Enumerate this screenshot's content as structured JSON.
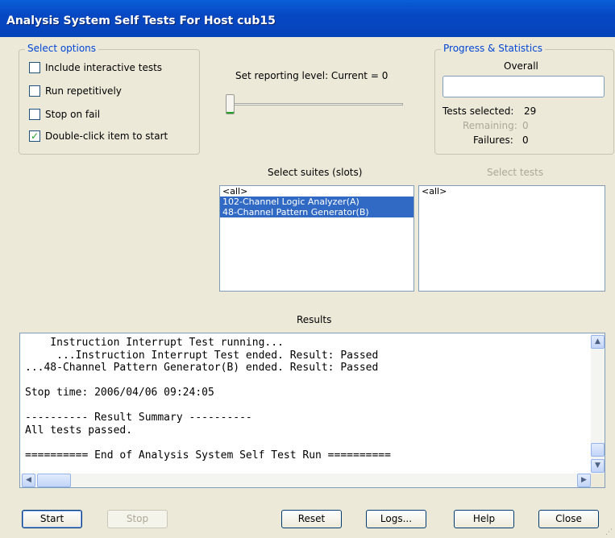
{
  "window": {
    "title": "Analysis System Self Tests For Host cub15"
  },
  "options": {
    "legend": "Select options",
    "items": [
      {
        "label": "Include interactive tests",
        "checked": false
      },
      {
        "label": "Run repetitively",
        "checked": false
      },
      {
        "label": "Stop on fail",
        "checked": false
      },
      {
        "label": "Double-click item to start",
        "checked": true
      }
    ]
  },
  "reporting": {
    "label": "Set reporting level: Current = 0",
    "level": 0
  },
  "progress": {
    "legend": "Progress & Statistics",
    "overall_label": "Overall",
    "overall_value": 0,
    "tests_selected_label": "Tests selected:",
    "tests_selected_value": "29",
    "remaining_label": "Remaining:",
    "remaining_value": "0",
    "failures_label": "Failures:",
    "failures_value": "0"
  },
  "suites": {
    "label": "Select suites (slots)",
    "items": [
      {
        "text": "<all>",
        "selected": false
      },
      {
        "text": "102-Channel Logic Analyzer(A)",
        "selected": true
      },
      {
        "text": "48-Channel Pattern Generator(B)",
        "selected": true
      }
    ]
  },
  "tests": {
    "label": "Select tests",
    "items": [
      "<all>"
    ]
  },
  "results": {
    "label": "Results",
    "lines": [
      "    Instruction Interrupt Test running...",
      "     ...Instruction Interrupt Test ended. Result: Passed",
      "...48-Channel Pattern Generator(B) ended. Result: Passed",
      "",
      "Stop time: 2006/04/06 09:24:05",
      "",
      "---------- Result Summary ----------",
      "All tests passed.",
      "",
      "========== End of Analysis System Self Test Run =========="
    ]
  },
  "buttons": {
    "start": "Start",
    "stop": "Stop",
    "reset": "Reset",
    "logs": "Logs...",
    "help": "Help",
    "close": "Close"
  },
  "colors": {
    "title_bar": "#0648c4",
    "selection": "#316ac5",
    "group_legend": "#0046d5"
  }
}
